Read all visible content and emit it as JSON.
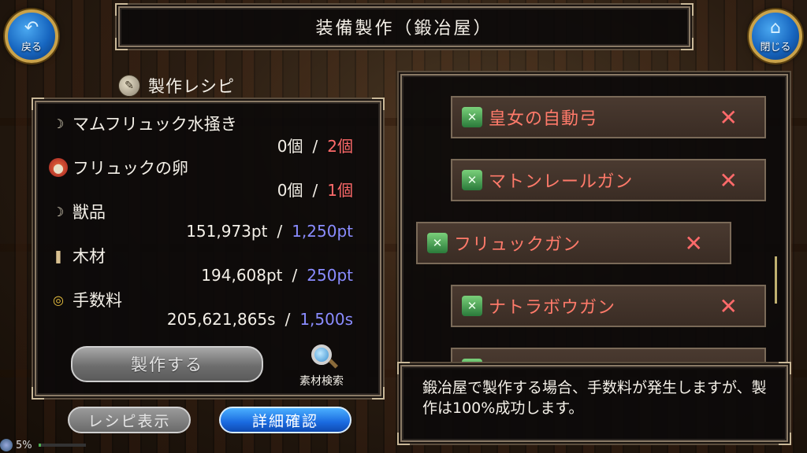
{
  "title": "装備製作（鍛冶屋）",
  "nav": {
    "back_label": "戻る",
    "close_label": "閉じる"
  },
  "recipe": {
    "header": "製作レシピ",
    "materials": [
      {
        "name": "マムフリュック水掻き",
        "owned": "0個",
        "required": "2個",
        "icon": "claw-icon"
      },
      {
        "name": "フリュックの卵",
        "owned": "0個",
        "required": "1個",
        "icon": "egg-icon"
      },
      {
        "name": "獣品",
        "owned": "151,973pt",
        "required": "1,250pt",
        "icon": "claw-icon"
      },
      {
        "name": "木材",
        "owned": "194,608pt",
        "required": "250pt",
        "icon": "wood-icon"
      },
      {
        "name": "手数料",
        "owned": "205,621,865s",
        "required": "1,500s",
        "icon": "coin-icon"
      }
    ],
    "separator": "/",
    "craft_label": "製作する",
    "search_label": "素材検索"
  },
  "buttons": {
    "recipe_display": "レシピ表示",
    "detail": "詳細確認"
  },
  "list": {
    "items": [
      {
        "name": "皇女の自動弓",
        "selected": false
      },
      {
        "name": "マトンレールガン",
        "selected": false
      },
      {
        "name": "フリュックガン",
        "selected": true
      },
      {
        "name": "ナトラボウガン",
        "selected": false
      },
      {
        "name": "",
        "selected": false
      }
    ],
    "remove_glyph": "✕"
  },
  "message": "鍛冶屋で製作する場合、手数料が発生しますが、製作は100%成功します。",
  "status": {
    "percent": "5%",
    "progress": 0.05
  },
  "colors": {
    "required_item": "#ff6a6a",
    "required_points": "#8a8cff",
    "list_text": "#ff7a6a",
    "accent_blue": "#1a6ae0"
  }
}
